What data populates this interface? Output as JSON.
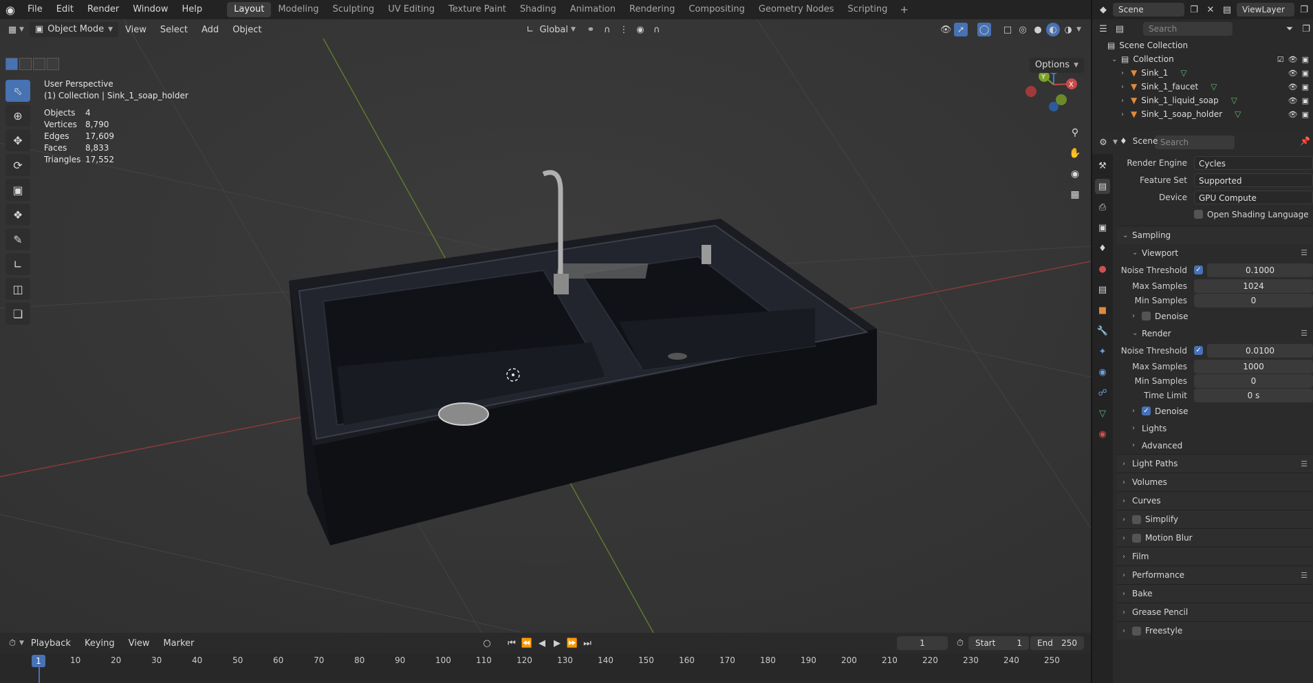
{
  "topbar": {
    "menus": [
      "File",
      "Edit",
      "Render",
      "Window",
      "Help"
    ],
    "workspaces": [
      "Layout",
      "Modeling",
      "Sculpting",
      "UV Editing",
      "Texture Paint",
      "Shading",
      "Animation",
      "Rendering",
      "Compositing",
      "Geometry Nodes",
      "Scripting"
    ],
    "active_workspace": "Layout",
    "scene": "Scene",
    "view_layer": "ViewLayer"
  },
  "viewport_header": {
    "mode": "Object Mode",
    "menus": [
      "View",
      "Select",
      "Add",
      "Object"
    ],
    "transform_orientation": "Global",
    "options": "Options"
  },
  "viewport": {
    "view_name": "User Perspective",
    "collection_label": "(1) Collection | Sink_1_soap_holder",
    "stats": [
      {
        "k": "Objects",
        "v": "4"
      },
      {
        "k": "Vertices",
        "v": "8,790"
      },
      {
        "k": "Edges",
        "v": "17,609"
      },
      {
        "k": "Faces",
        "v": "8,833"
      },
      {
        "k": "Triangles",
        "v": "17,552"
      }
    ],
    "gizmo": {
      "x": "X",
      "y": "Y",
      "z": "Z"
    }
  },
  "timeline": {
    "menus": [
      "Playback",
      "Keying",
      "View",
      "Marker"
    ],
    "current_frame": "1",
    "start_label": "Start",
    "start": "1",
    "end_label": "End",
    "end": "250",
    "ticks": [
      "10",
      "20",
      "30",
      "40",
      "50",
      "60",
      "70",
      "80",
      "90",
      "100",
      "110",
      "120",
      "130",
      "140",
      "150",
      "160",
      "170",
      "180",
      "190",
      "200",
      "210",
      "220",
      "230",
      "240",
      "250"
    ],
    "cursor_frame": "1"
  },
  "outliner": {
    "search_placeholder": "Search",
    "root": "Scene Collection",
    "collection": "Collection",
    "items": [
      "Sink_1",
      "Sink_1_faucet",
      "Sink_1_liquid_soap",
      "Sink_1_soap_holder"
    ]
  },
  "properties": {
    "search_placeholder": "Search",
    "context": "Scene",
    "render_engine_label": "Render Engine",
    "render_engine": "Cycles",
    "feature_set_label": "Feature Set",
    "feature_set": "Supported",
    "device_label": "Device",
    "device": "GPU Compute",
    "osl_label": "Open Shading Language",
    "sampling": "Sampling",
    "viewport": "Viewport",
    "noise_threshold_label": "Noise Threshold",
    "vp_noise_threshold": "0.1000",
    "max_samples_label": "Max Samples",
    "vp_max_samples": "1024",
    "min_samples_label": "Min Samples",
    "vp_min_samples": "0",
    "denoise": "Denoise",
    "render": "Render",
    "r_noise_threshold": "0.0100",
    "r_max_samples": "1000",
    "r_min_samples": "0",
    "time_limit_label": "Time Limit",
    "r_time_limit": "0 s",
    "lights": "Lights",
    "advanced": "Advanced",
    "sections": [
      "Light Paths",
      "Volumes",
      "Curves",
      "Simplify",
      "Motion Blur",
      "Film",
      "Performance",
      "Bake",
      "Grease Pencil",
      "Freestyle"
    ]
  }
}
